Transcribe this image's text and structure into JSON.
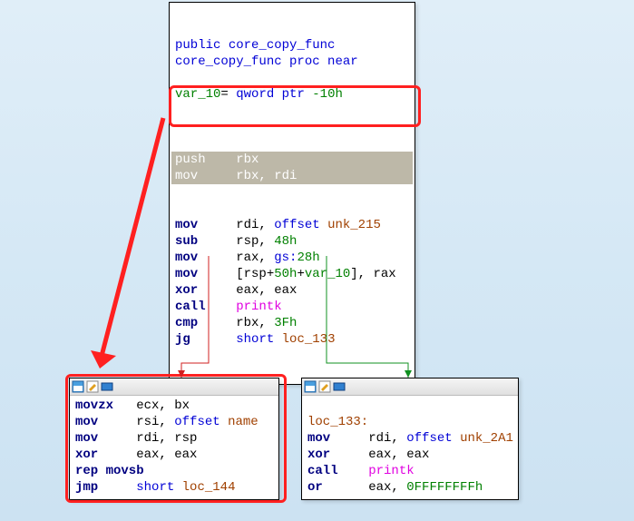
{
  "top_block": {
    "lines": [
      {
        "segs": [
          {
            "t": "public",
            "c": "kw-blue"
          },
          {
            "t": " "
          },
          {
            "t": "core_copy_func",
            "c": "kw-blue"
          }
        ]
      },
      {
        "segs": [
          {
            "t": "core_copy_func",
            "c": "kw-blue"
          },
          {
            "t": " "
          },
          {
            "t": "proc near",
            "c": "kw-blue"
          }
        ]
      },
      {
        "segs": [
          {
            "t": " "
          }
        ]
      },
      {
        "segs": [
          {
            "t": "var_10",
            "c": "hex"
          },
          {
            "t": "= "
          },
          {
            "t": "qword ptr",
            "c": "kw-blue"
          },
          {
            "t": " "
          },
          {
            "t": "-10h",
            "c": "hex"
          }
        ]
      },
      {
        "segs": [
          {
            "t": " "
          }
        ]
      }
    ],
    "sel_lines": [
      {
        "segs": [
          {
            "t": "push    rbx"
          }
        ]
      },
      {
        "segs": [
          {
            "t": "mov     rbx, rdi"
          }
        ]
      }
    ],
    "after_lines": [
      {
        "segs": [
          {
            "t": "mov",
            "c": "kw-navy"
          },
          {
            "t": "     rdi, "
          },
          {
            "t": "offset",
            "c": "kw-blue"
          },
          {
            "t": " "
          },
          {
            "t": "unk_215",
            "c": "addr"
          }
        ]
      },
      {
        "segs": [
          {
            "t": "sub",
            "c": "kw-navy"
          },
          {
            "t": "     rsp, "
          },
          {
            "t": "48h",
            "c": "hex"
          }
        ]
      },
      {
        "segs": [
          {
            "t": "mov",
            "c": "kw-navy"
          },
          {
            "t": "     rax, "
          },
          {
            "t": "gs:",
            "c": "kw-blue"
          },
          {
            "t": "28h",
            "c": "hex"
          }
        ]
      },
      {
        "segs": [
          {
            "t": "mov",
            "c": "kw-navy"
          },
          {
            "t": "     [rsp+"
          },
          {
            "t": "50h",
            "c": "hex"
          },
          {
            "t": "+"
          },
          {
            "t": "var_10",
            "c": "hex"
          },
          {
            "t": "], rax"
          }
        ]
      },
      {
        "segs": [
          {
            "t": "xor",
            "c": "kw-navy"
          },
          {
            "t": "     eax, eax"
          }
        ]
      },
      {
        "segs": [
          {
            "t": "call",
            "c": "kw-navy"
          },
          {
            "t": "    "
          },
          {
            "t": "printk",
            "c": "func"
          }
        ]
      },
      {
        "segs": [
          {
            "t": "cmp",
            "c": "kw-navy"
          },
          {
            "t": "     rbx, "
          },
          {
            "t": "3Fh",
            "c": "hex"
          }
        ]
      },
      {
        "segs": [
          {
            "t": "jg",
            "c": "kw-navy"
          },
          {
            "t": "      "
          },
          {
            "t": "short",
            "c": "kw-blue"
          },
          {
            "t": " "
          },
          {
            "t": "loc_133",
            "c": "addr"
          }
        ]
      }
    ]
  },
  "left_block": {
    "lines": [
      {
        "segs": [
          {
            "t": "movzx",
            "c": "kw-navy"
          },
          {
            "t": "   ecx, bx"
          }
        ]
      },
      {
        "segs": [
          {
            "t": "mov",
            "c": "kw-navy"
          },
          {
            "t": "     rsi, "
          },
          {
            "t": "offset",
            "c": "kw-blue"
          },
          {
            "t": " "
          },
          {
            "t": "name",
            "c": "addr"
          }
        ]
      },
      {
        "segs": [
          {
            "t": "mov",
            "c": "kw-navy"
          },
          {
            "t": "     rdi, rsp"
          }
        ]
      },
      {
        "segs": [
          {
            "t": "xor",
            "c": "kw-navy"
          },
          {
            "t": "     eax, eax"
          }
        ]
      },
      {
        "segs": [
          {
            "t": "rep movsb",
            "c": "kw-navy"
          }
        ]
      },
      {
        "segs": [
          {
            "t": "jmp",
            "c": "kw-navy"
          },
          {
            "t": "     "
          },
          {
            "t": "short",
            "c": "kw-blue"
          },
          {
            "t": " "
          },
          {
            "t": "loc_144",
            "c": "addr"
          }
        ]
      }
    ]
  },
  "right_block": {
    "lines": [
      {
        "segs": [
          {
            "t": " "
          }
        ]
      },
      {
        "segs": [
          {
            "t": "loc_133:",
            "c": "addr"
          }
        ]
      },
      {
        "segs": [
          {
            "t": "mov",
            "c": "kw-navy"
          },
          {
            "t": "     rdi, "
          },
          {
            "t": "offset",
            "c": "kw-blue"
          },
          {
            "t": " "
          },
          {
            "t": "unk_2A1",
            "c": "addr"
          }
        ]
      },
      {
        "segs": [
          {
            "t": "xor",
            "c": "kw-navy"
          },
          {
            "t": "     eax, eax"
          }
        ]
      },
      {
        "segs": [
          {
            "t": "call",
            "c": "kw-navy"
          },
          {
            "t": "    "
          },
          {
            "t": "printk",
            "c": "func"
          }
        ]
      },
      {
        "segs": [
          {
            "t": "or",
            "c": "kw-navy"
          },
          {
            "t": "      eax, "
          },
          {
            "t": "0FFFFFFFFh",
            "c": "hex"
          }
        ]
      }
    ]
  }
}
